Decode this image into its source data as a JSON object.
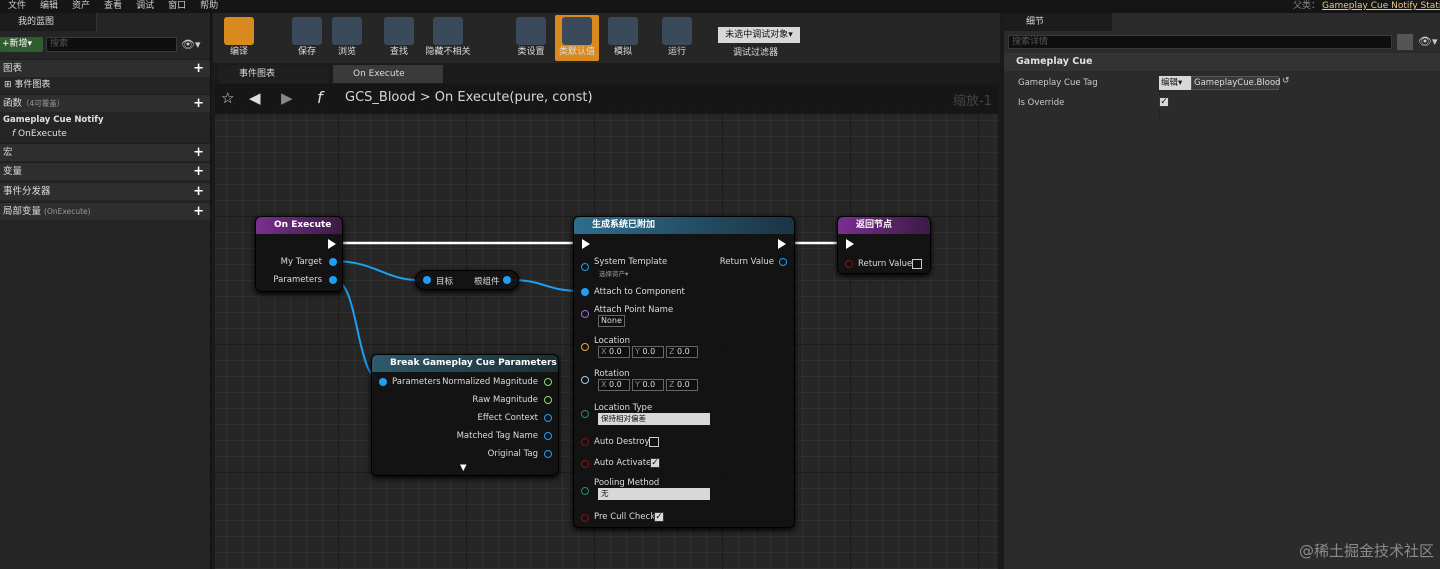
{
  "menu": [
    "文件",
    "编辑",
    "资产",
    "查看",
    "调试",
    "窗口",
    "帮助"
  ],
  "parent_label": "父类：",
  "parent_class": "Gameplay Cue Notify Static",
  "left_panel": {
    "tab": "我的蓝图",
    "new_button": "+新增▾",
    "search_placeholder": "搜索",
    "sections": {
      "graphs": "图表",
      "event_graph": "事件图表",
      "functions": "函数",
      "functions_note": "（4可覆盖）",
      "gc_notify": "Gameplay Cue Notify",
      "on_execute": "OnExecute",
      "macros": "宏",
      "variables": "变量",
      "dispatchers": "事件分发器",
      "local_vars": "局部变量",
      "local_vars_note": "(OnExecute)"
    }
  },
  "toolbar": {
    "compile": "编译",
    "save": "保存",
    "browse": "浏览",
    "find": "查找",
    "hide": "隐藏不相关",
    "class_settings": "类设置",
    "class_defaults": "类默认值",
    "simulate": "模拟",
    "run": "运行",
    "debug_select": "未选中调试对象▾",
    "debug_filter": "调试过滤器"
  },
  "tabs": {
    "event_graph": "事件图表",
    "on_execute": "On Execute"
  },
  "breadcrumb": {
    "bp": "GCS_Blood",
    "sep": ">",
    "func": "On Execute(pure, const)"
  },
  "zoom": "缩放-1",
  "nodes": {
    "entry": {
      "title": "On Execute",
      "pin1": "My Target",
      "pin2": "Parameters"
    },
    "reroute": {
      "a": "目标",
      "b": "根组件"
    },
    "spawn": {
      "title": "生成系统已附加",
      "system_template": "System Template",
      "select_asset": "选择资产▾",
      "return_value": "Return Value",
      "attach_component": "Attach to Component",
      "attach_point": "Attach Point Name",
      "attach_point_val": "None",
      "location": "Location",
      "rotation": "Rotation",
      "x": "X",
      "y": "Y",
      "z": "Z",
      "zero": "0.0",
      "location_type": "Location Type",
      "location_type_val": "保持相对偏差",
      "auto_destroy": "Auto Destroy",
      "auto_activate": "Auto Activate",
      "pooling": "Pooling Method",
      "pooling_val": "无",
      "pre_cull": "Pre Cull Check"
    },
    "return": {
      "title": "返回节点",
      "pin": "Return Value"
    },
    "break": {
      "title": "Break Gameplay Cue Parameters",
      "params": "Parameters",
      "norm_mag": "Normalized Magnitude",
      "raw_mag": "Raw Magnitude",
      "effect_ctx": "Effect Context",
      "matched_tag": "Matched Tag Name",
      "orig_tag": "Original Tag",
      "expand": "▼"
    }
  },
  "details": {
    "tab": "细节",
    "search_placeholder": "搜索详情",
    "category": "Gameplay Cue",
    "tag_label": "Gameplay Cue Tag",
    "edit_button": "编辑▾",
    "tag_value": "GameplayCue.Blood",
    "override_label": "Is Override"
  },
  "watermark": "@稀土掘金技术社区"
}
